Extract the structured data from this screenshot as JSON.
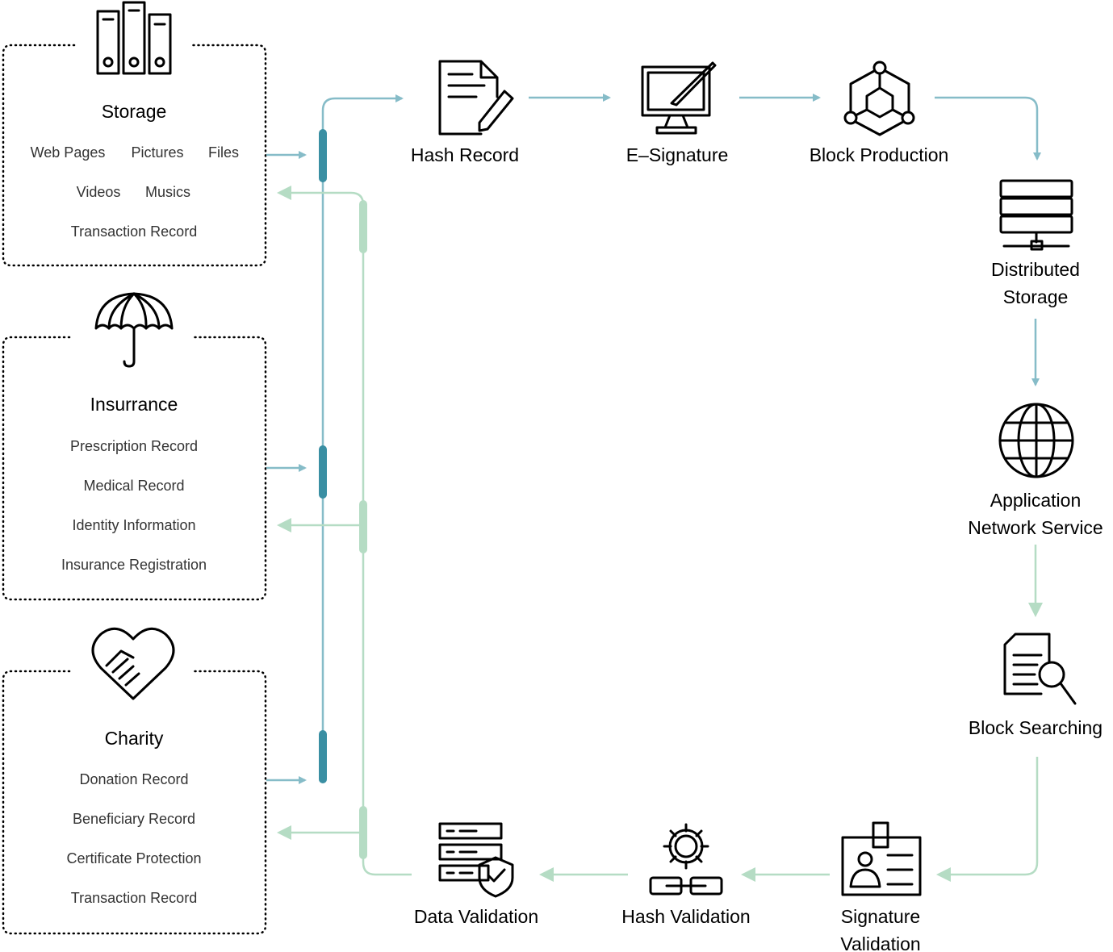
{
  "colors": {
    "flow_blue": "#86bcc8",
    "bar_blue": "#3a8fa3",
    "flow_green": "#b5dcc4"
  },
  "sources": [
    {
      "title": "Storage",
      "icon": "binders-icon",
      "items": [
        "Web Pages",
        "Pictures",
        "Files",
        "Videos",
        "Musics",
        "Transaction Record"
      ]
    },
    {
      "title": "Insurrance",
      "icon": "umbrella-icon",
      "items": [
        "Prescription Record",
        "Medical Record",
        "Identity Information",
        "Insurance Registration"
      ]
    },
    {
      "title": "Charity",
      "icon": "handshake-heart-icon",
      "items": [
        "Donation Record",
        "Beneficiary Record",
        "Certificate Protection",
        "Transaction Record"
      ]
    }
  ],
  "steps": {
    "hash_record": "Hash Record",
    "e_signature": "E–Signature",
    "block_production": "Block Production",
    "distributed_storage": [
      "Distributed",
      "Storage"
    ],
    "app_network": [
      "Application",
      "Network Service"
    ],
    "block_searching": "Block Searching",
    "signature_validation": [
      "Signature",
      "Validation"
    ],
    "hash_validation": "Hash Validation",
    "data_validation": "Data Validation"
  }
}
